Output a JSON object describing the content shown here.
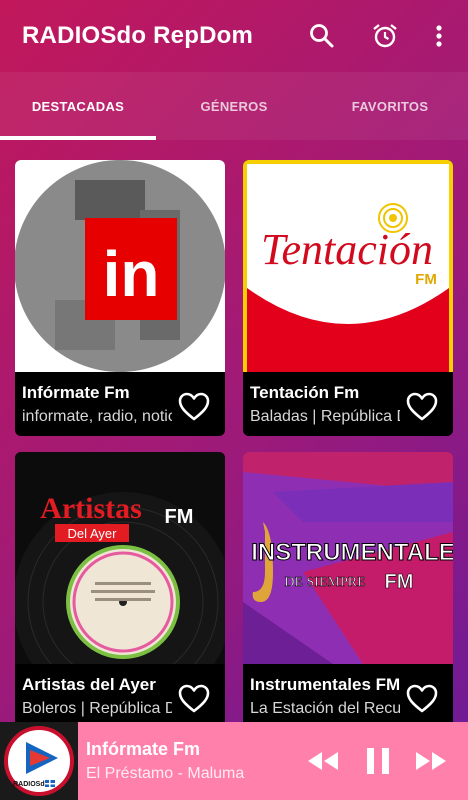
{
  "app": {
    "title": "RADIOSdo RepDom",
    "icons": [
      "search-icon",
      "alarm-icon",
      "more-vert-icon"
    ]
  },
  "tabs": [
    {
      "label": "DESTACADAS",
      "active": true
    },
    {
      "label": "GÉNEROS",
      "active": false
    },
    {
      "label": "FAVORITOS",
      "active": false
    }
  ],
  "stations": [
    {
      "name": "Infórmate Fm",
      "description": "informate, radio, noticias",
      "logo_text": "in",
      "favorite": false
    },
    {
      "name": "Tentación Fm",
      "description": "Baladas | República Dominicana",
      "logo_text": "Tentación",
      "logo_sub": "FM",
      "favorite": false
    },
    {
      "name": "Artistas del Ayer",
      "description": "Boleros | República Dominicana",
      "logo_text_1": "Artistas",
      "logo_text_2": "Del Ayer",
      "logo_sub": "FM",
      "favorite": false
    },
    {
      "name": "Instrumentales FM",
      "description": "La Estación del Recuerdo",
      "logo_text_1": "INSTRUMENTALES",
      "logo_text_2": "DE SIEMPRE",
      "logo_sub": "FM",
      "favorite": false
    }
  ],
  "player": {
    "station": "Infórmate Fm",
    "now_playing": "El Préstamo - Maluma",
    "logo_text": "RADIOSdo",
    "controls": [
      "rewind-icon",
      "pause-icon",
      "fast-forward-icon"
    ]
  },
  "colors": {
    "gradient_start": "#c2185b",
    "gradient_end": "#6a1b9a",
    "player_bg": "#ff80ab",
    "card_bg": "#000000"
  }
}
